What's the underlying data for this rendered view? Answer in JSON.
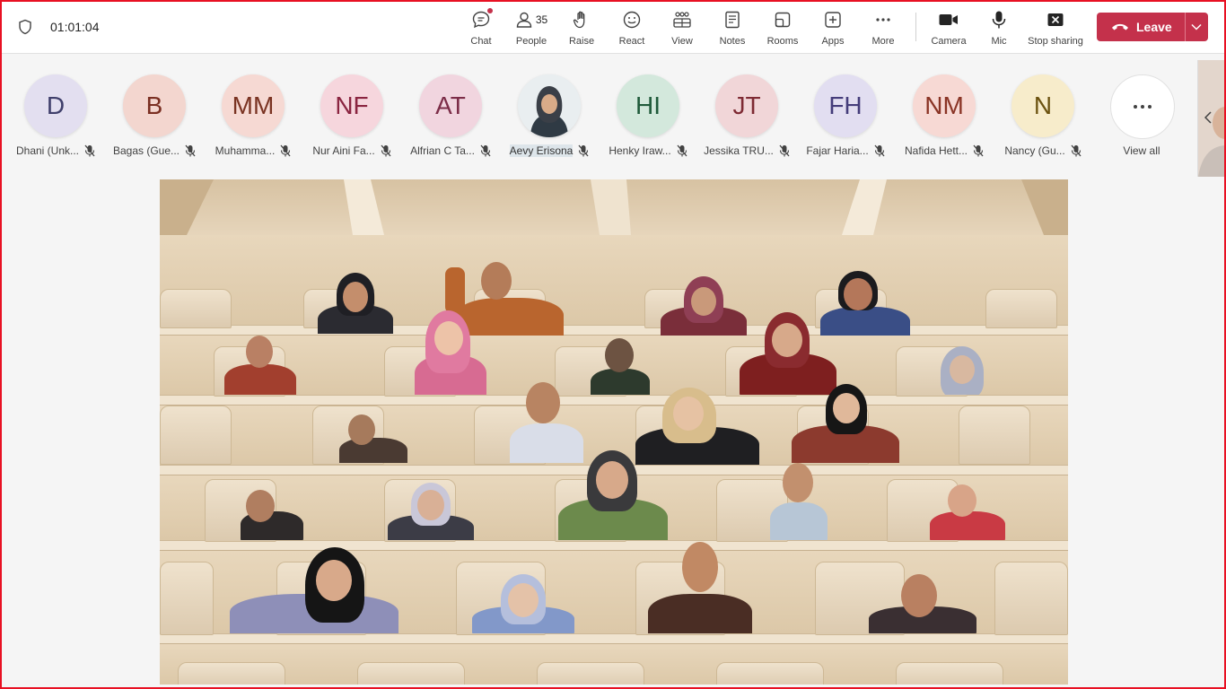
{
  "meeting": {
    "timer": "01:01:04"
  },
  "toolbar": {
    "chat": "Chat",
    "people": "People",
    "people_count": "35",
    "raise": "Raise",
    "react": "React",
    "view": "View",
    "notes": "Notes",
    "rooms": "Rooms",
    "apps": "Apps",
    "more": "More",
    "camera": "Camera",
    "mic": "Mic",
    "stop_sharing": "Stop sharing",
    "leave": "Leave"
  },
  "participants": [
    {
      "initials": "D",
      "name": "Dhani (Unk...",
      "bg": "#e3dff0",
      "fg": "#3f3f6b"
    },
    {
      "initials": "B",
      "name": "Bagas (Gue...",
      "bg": "#f3d6cf",
      "fg": "#7a2f22"
    },
    {
      "initials": "MM",
      "name": "Muhamma...",
      "bg": "#f6d9d3",
      "fg": "#7a3322"
    },
    {
      "initials": "NF",
      "name": "Nur Aini Fa...",
      "bg": "#f6d6dd",
      "fg": "#8a2440"
    },
    {
      "initials": "AT",
      "name": "Alfrian C Ta...",
      "bg": "#f1d5df",
      "fg": "#7c2d48"
    },
    {
      "initials": "",
      "name": "Aevy Erisona",
      "bg": "#dde5ea",
      "fg": "#333333"
    },
    {
      "initials": "HI",
      "name": "Henky Iraw...",
      "bg": "#d3e8dc",
      "fg": "#1f5a3a"
    },
    {
      "initials": "JT",
      "name": "Jessika TRU...",
      "bg": "#f1d6d8",
      "fg": "#7e2a33"
    },
    {
      "initials": "FH",
      "name": "Fajar Haria...",
      "bg": "#e2def1",
      "fg": "#443c7a"
    },
    {
      "initials": "NM",
      "name": "Nafida Hett...",
      "bg": "#f7d9d4",
      "fg": "#8a3425"
    },
    {
      "initials": "N",
      "name": "Nancy (Gu...",
      "bg": "#f7eccb",
      "fg": "#6b5210"
    }
  ],
  "view_all": "View all",
  "colors": {
    "leave": "#c4314b",
    "border": "#e81123"
  }
}
